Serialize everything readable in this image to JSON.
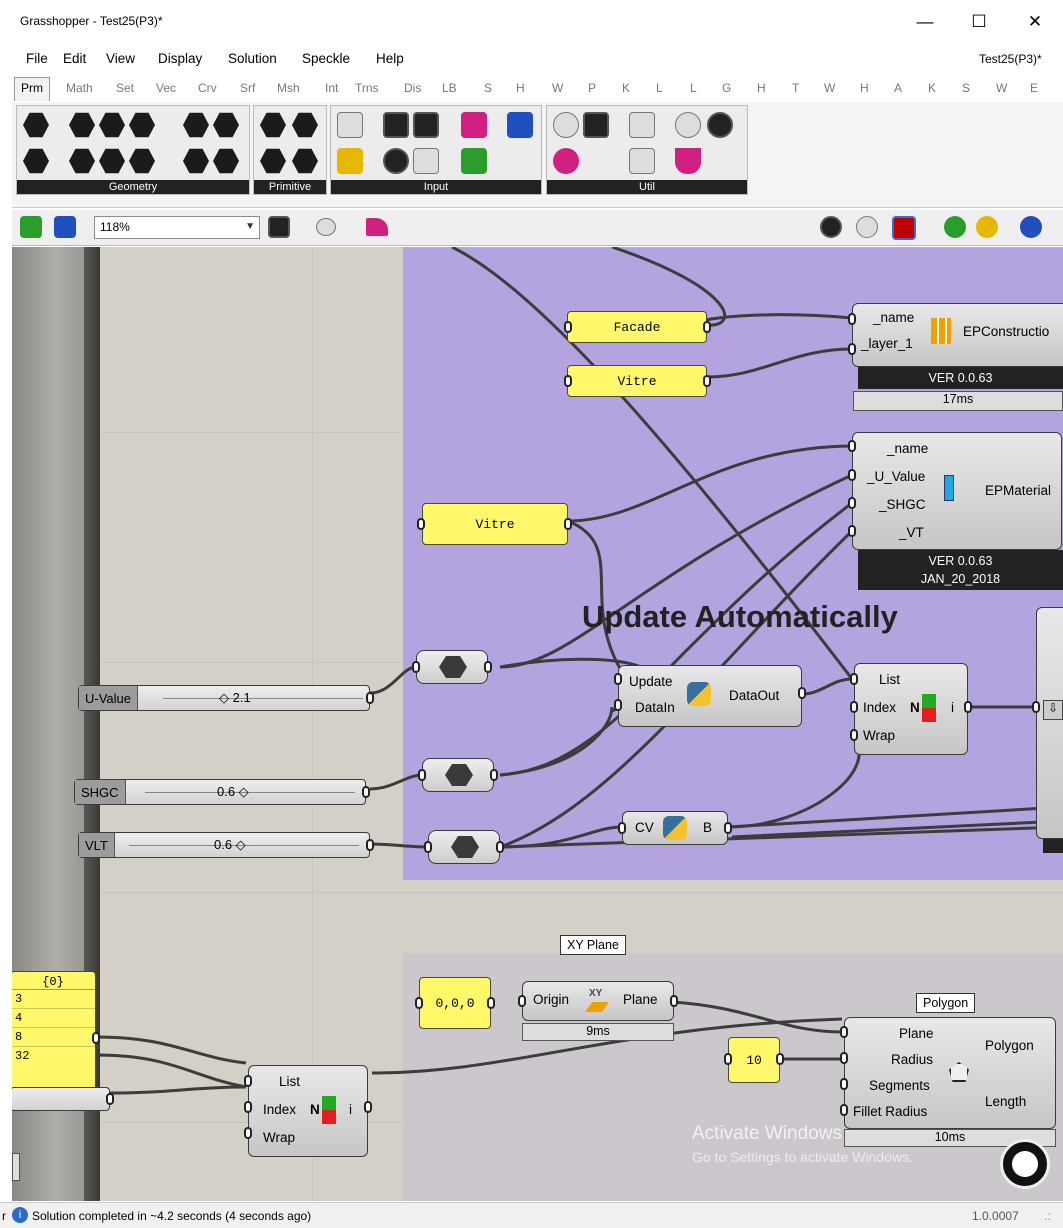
{
  "window": {
    "title": "Grasshopper - Test25(P3)*",
    "minimize": "—",
    "maximize": "☐",
    "close": "✕"
  },
  "menu": {
    "items": [
      "File",
      "Edit",
      "View",
      "Display",
      "Solution",
      "Speckle",
      "Help"
    ],
    "doc_title": "Test25(P3)*"
  },
  "tabs": [
    "Prm",
    "Math",
    "Set",
    "Vec",
    "Crv",
    "Srf",
    "Msh",
    "Int",
    "Trns",
    "Dis",
    "LB",
    "S",
    "H",
    "W",
    "P",
    "K",
    "L",
    "L",
    "G",
    "H",
    "T",
    "W",
    "H",
    "A",
    "K",
    "S",
    "W",
    "E"
  ],
  "ribbon": {
    "panels": [
      "Geometry",
      "Primitive",
      "Input",
      "Util"
    ]
  },
  "toolbar": {
    "zoom": "118%"
  },
  "canvas": {
    "group_label": "Update Automatically",
    "panels": {
      "facade": "Facade",
      "vitre_top": "Vitre",
      "vitre_mid": "Vitre",
      "origin": "0,0,0",
      "radius": "10"
    },
    "epconstruction": {
      "in1": "_name",
      "in2": "_layer_1",
      "name": "EPConstructio",
      "ver": "VER 0.0.63",
      "time": "17ms"
    },
    "epmaterial": {
      "in1": "_name",
      "in2": "_U_Value",
      "in3": "_SHGC",
      "in4": "_VT",
      "name": "EPMaterial",
      "ver": "VER 0.0.63",
      "date": "JAN_20_2018"
    },
    "sliders": [
      {
        "name": "U-Value",
        "value": "◇ 2.1"
      },
      {
        "name": "SHGC",
        "value": "0.6 ◇"
      },
      {
        "name": "VLT",
        "value": "0.6 ◇"
      }
    ],
    "python1": {
      "in1": "Update",
      "in2": "DataIn",
      "out": "DataOut"
    },
    "python2": {
      "in": "CV",
      "out": "B"
    },
    "listitem1": {
      "in1": "List",
      "in2": "Index",
      "in3": "Wrap",
      "icon": "N",
      "out": "i"
    },
    "listitem2": {
      "in1": "List",
      "in2": "Index",
      "in3": "Wrap",
      "icon": "N",
      "out": "i"
    },
    "xyplane": {
      "tip": "XY Plane",
      "in": "Origin",
      "icon": "XY",
      "out": "Plane",
      "time": "9ms"
    },
    "polygon": {
      "tip": "Polygon",
      "in1": "Plane",
      "in2": "Radius",
      "in3": "Segments",
      "in4": "Fillet Radius",
      "out1": "Polygon",
      "out2": "Length",
      "time": "10ms"
    },
    "panel_list": {
      "header": "{0}",
      "rows": [
        "3",
        "4",
        "8",
        "32"
      ]
    },
    "watermark": {
      "line1": "Activate Windows",
      "line2": "Go to Settings to activate Windows."
    }
  },
  "status": {
    "left_char": "r",
    "message": "Solution completed in ~4.2 seconds (4 seconds ago)",
    "version": "1.0.0007"
  }
}
